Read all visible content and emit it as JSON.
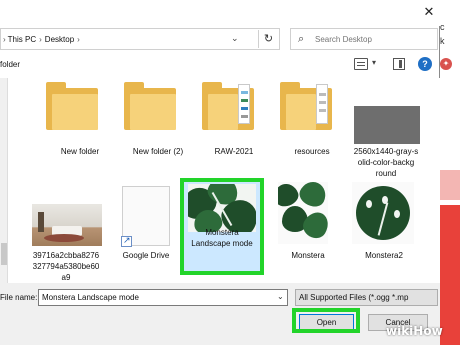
{
  "address_bar": {
    "crumbs": [
      "This PC",
      "Desktop"
    ]
  },
  "search": {
    "placeholder": "Search Desktop"
  },
  "toolbar": {
    "folder_label": "folder"
  },
  "items": [
    {
      "name": "New folder",
      "kind": "folder"
    },
    {
      "name": "New folder (2)",
      "kind": "folder"
    },
    {
      "name": "RAW-2021",
      "kind": "folder"
    },
    {
      "name": "resources",
      "kind": "folder"
    },
    {
      "name": "2560x1440-gray-solid-color-background",
      "kind": "image",
      "label_lines": [
        "2560x1440-gray-s",
        "olid-color-backg",
        "round"
      ]
    },
    {
      "name": "39716a2cbba8276327794a5380be60a9",
      "kind": "image",
      "label_lines": [
        "39716a2cbba8276",
        "327794a5380be60",
        "a9"
      ]
    },
    {
      "name": "Google Drive",
      "kind": "shortcut"
    },
    {
      "name": "Monstera Landscape mode",
      "kind": "image",
      "selected": true,
      "label_lines": [
        "Monstera",
        "Landscape mode"
      ]
    },
    {
      "name": "Monstera",
      "kind": "image"
    },
    {
      "name": "Monstera2",
      "kind": "image"
    }
  ],
  "bottom": {
    "file_name_label": "File name:",
    "file_name_value": "Monstera Landscape mode",
    "file_type": "All Supported Files (*.ogg *.mp",
    "open_label": "Open",
    "cancel_label": "Cancel"
  },
  "watermark": {
    "a": "wiki",
    "b": "How"
  },
  "colors": {
    "highlight": "#22d42a",
    "selection": "#cce8ff",
    "folder": "#e8b64c"
  },
  "icons": [
    "close-icon",
    "refresh-icon",
    "search-icon",
    "view-icon",
    "preview-pane-icon",
    "help-icon",
    "shortcut-arrow-icon"
  ]
}
